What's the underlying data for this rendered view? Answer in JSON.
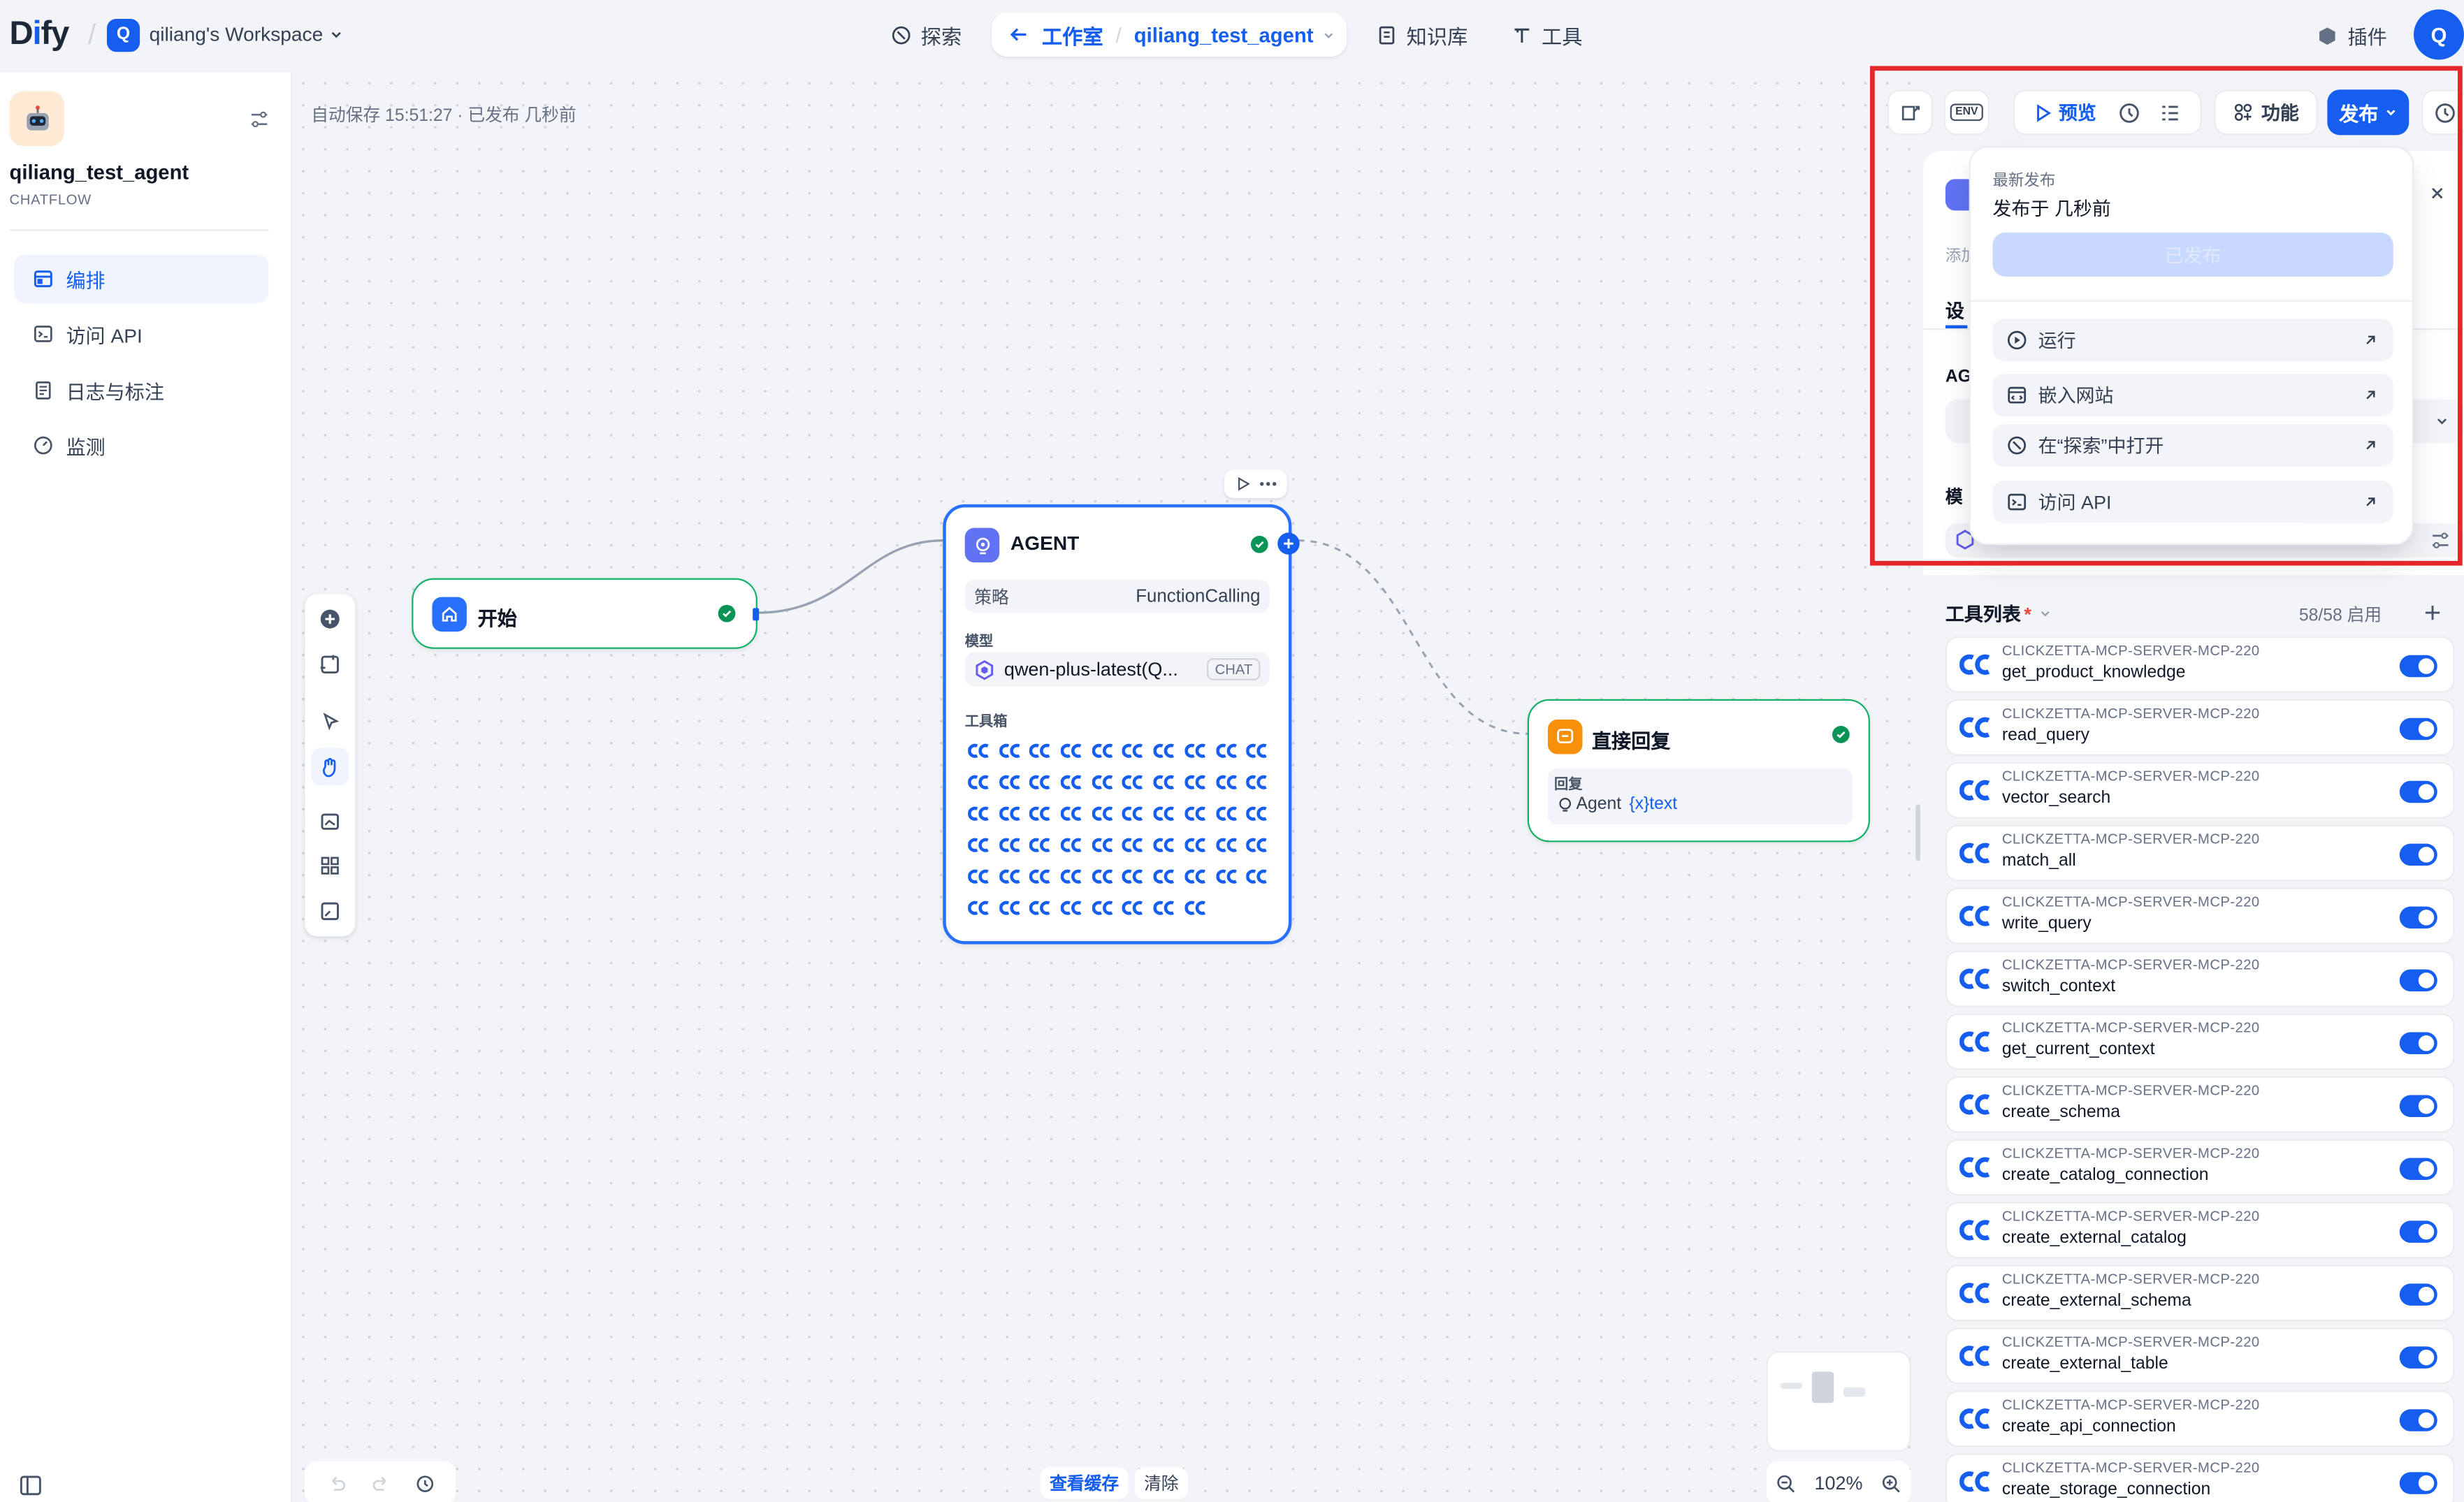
{
  "header": {
    "logo": {
      "pre": "D",
      "mid": "i",
      "post": "fy"
    },
    "workspace_badge": "Q",
    "workspace_name": "qiliang's Workspace",
    "nav_explore": "探索",
    "nav_studio": "工作室",
    "nav_app": "qiliang_test_agent",
    "nav_knowledge": "知识库",
    "nav_tools": "工具",
    "plugins": "插件",
    "avatar": "Q"
  },
  "sidebar": {
    "app_name": "qiliang_test_agent",
    "app_type": "CHATFLOW",
    "items": [
      {
        "label": "编排",
        "active": true
      },
      {
        "label": "访问 API",
        "active": false
      },
      {
        "label": "日志与标注",
        "active": false
      },
      {
        "label": "监测",
        "active": false
      }
    ]
  },
  "canvas": {
    "autosave": "自动保存 15:51:27 · 已发布 几秒前",
    "start_node": {
      "title": "开始"
    },
    "agent_node": {
      "title": "AGENT",
      "strategy_label": "策略",
      "strategy_value": "FunctionCalling",
      "model_label": "模型",
      "model_value": "qwen-plus-latest(Q...",
      "model_badge": "CHAT",
      "toolbox_label": "工具箱",
      "tool_count": 58
    },
    "reply_node": {
      "title": "直接回复",
      "reply_label": "回复",
      "var_agent": "Agent",
      "var_text": "{x}text"
    },
    "view_cache": "查看缓存",
    "clear": "清除",
    "zoom": "102%"
  },
  "toolbar": {
    "env": "ENV",
    "preview": "预览",
    "features": "功能",
    "publish": "发布"
  },
  "publish_popup": {
    "title": "最新发布",
    "subtitle": "发布于 几秒前",
    "published_btn": "已发布",
    "items": [
      {
        "label": "运行"
      },
      {
        "label": "嵌入网站"
      },
      {
        "label": "在“探索”中打开"
      },
      {
        "label": "访问 API"
      }
    ]
  },
  "panel": {
    "frag_add": "添加",
    "frag_settings": "设",
    "frag_agent": "AG",
    "frag_model": "模",
    "tools_title": "工具列表",
    "required_mark": "*",
    "tools_count": "58/58 启用",
    "tool_provider": "CLICKZETTA-MCP-SERVER-MCP-220",
    "tools": [
      {
        "name": "get_product_knowledge"
      },
      {
        "name": "read_query"
      },
      {
        "name": "vector_search"
      },
      {
        "name": "match_all"
      },
      {
        "name": "write_query"
      },
      {
        "name": "switch_context"
      },
      {
        "name": "get_current_context"
      },
      {
        "name": "create_schema"
      },
      {
        "name": "create_catalog_connection"
      },
      {
        "name": "create_external_catalog"
      },
      {
        "name": "create_external_schema"
      },
      {
        "name": "create_external_table"
      },
      {
        "name": "create_api_connection"
      },
      {
        "name": "create_storage_connection"
      }
    ]
  },
  "colors": {
    "accent": "#155eef",
    "success": "#079455",
    "start_border": "#17b26a",
    "highlight": "#e5262b"
  }
}
